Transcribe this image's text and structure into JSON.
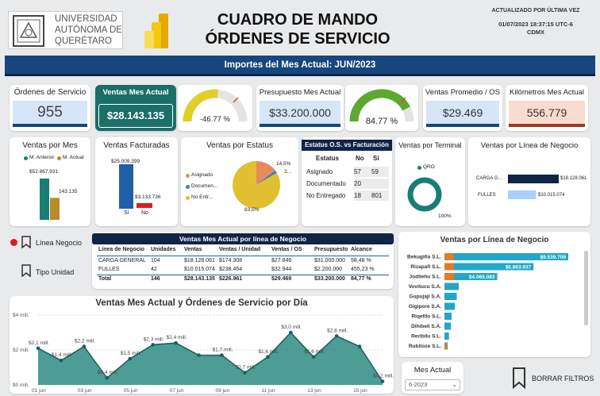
{
  "header": {
    "university": [
      "UNIVERSIDAD",
      "AUTÓNOMA DE",
      "QUERÉTARO"
    ],
    "title1": "CUADRO DE MANDO",
    "title2": "ÓRDENES DE SERVICIO",
    "updated_label": "ACTUALIZADO POR ÚLTIMA VEZ",
    "updated_value": "01/07/2023 18:37:15 UTC-6",
    "updated_tz": "CDMX"
  },
  "banner": "Importes del Mes Actual: JUN/2023",
  "colors": {
    "navy": "#0f2446",
    "blue": "#1f5fa8",
    "teal": "#1a7d73",
    "gold": "#e0b52a",
    "orange": "#e07b2a",
    "green": "#5ca832",
    "red": "#e01b1b"
  },
  "kpis": {
    "ordenes": {
      "label": "Órdenes de Servicio",
      "value": "955"
    },
    "ventas": {
      "label": "Ventas Mes Actual",
      "value": "$28.143.135"
    },
    "gauge1": {
      "value": "-46.77 %",
      "fraction": 0.53
    },
    "presupuesto": {
      "label": "Presupuesto Mes Actual",
      "value": "$33.200.000"
    },
    "gauge2": {
      "value": "84.77 %",
      "fraction": 0.8477
    },
    "promedio": {
      "label": "Ventas Promedio / OS",
      "value": "$29.469"
    },
    "km": {
      "label": "Kilómetros Mes Actual",
      "value": "556.779"
    }
  },
  "ventas_mes": {
    "title": "Ventas por Mes",
    "legend": [
      "M. Anterior",
      "M. Actual"
    ],
    "label_prev": "$52.867.931",
    "label_cur": "143.135",
    "prev": 52867931,
    "cur": 28143135
  },
  "facturadas": {
    "title": "Ventas Facturadas",
    "categories": [
      "Sí",
      "No"
    ],
    "labels": [
      "$25.009.399",
      "$3.133.736"
    ],
    "values": [
      25009399,
      3133736
    ]
  },
  "estatus": {
    "title": "Ventas por Estatus",
    "legend": [
      "Asignado",
      "Documen...",
      "No Entr..."
    ],
    "label_a": "14,5%",
    "label_b": "2...",
    "label_c": "83,5%",
    "values": [
      14.5,
      2,
      83.5
    ]
  },
  "estatus_os": {
    "title": "Estatus O.S. vs Facturación",
    "headers": [
      "Estatus",
      "No",
      "Sí"
    ],
    "rows": [
      [
        "Asignado",
        "57",
        "59"
      ],
      [
        "Documentado",
        "20",
        ""
      ],
      [
        "No Entregado",
        "18",
        "801"
      ]
    ]
  },
  "terminal": {
    "title": "Ventas por Terminal",
    "legend": "QRO",
    "pct": "100%"
  },
  "linea_small": {
    "title": "Ventas por Línea de Negocio",
    "rows": [
      {
        "name": "CARGA G...",
        "label": "$18.128.061",
        "value": 18128061
      },
      {
        "name": "FULLES",
        "label": "$10.015.074",
        "value": 10015074
      }
    ]
  },
  "bookmarks": {
    "linea": "Línea Negocio",
    "tipo": "Tipo Unidad",
    "borrar": "BORRAR FILTROS"
  },
  "tabla": {
    "title": "Ventas Mes Actual por línea de Negocio",
    "headers": [
      "Línea de Negocio",
      "Unidades",
      "Ventas",
      "Ventas / Unidad",
      "Ventas / OS",
      "Presupuesto",
      "Alcance"
    ],
    "rows": [
      [
        "CARGA GENERAL",
        "104",
        "$18.128.061",
        "$174.308",
        "$27.846",
        "$31.000.000",
        "58,48 %"
      ],
      [
        "FULLES",
        "42",
        "$10.015.074",
        "$238.454",
        "$32.944",
        "$2.200.000",
        "455,23 %"
      ]
    ],
    "total": [
      "Total",
      "146",
      "$28.143.135",
      "$226.961",
      "$29.469",
      "$33.200.000",
      "84,77 %"
    ]
  },
  "chart_data": {
    "type": "area",
    "title": "Ventas Mes Actual y Órdenes de Servicio por Día",
    "x": [
      "01 jun",
      "02 jun",
      "03 jun",
      "04 jun",
      "05 jun",
      "06 jun",
      "07 jun",
      "08 jun",
      "09 jun",
      "10 jun",
      "11 jun",
      "12 jun",
      "13 jun",
      "14 jun",
      "15 jun",
      "16 jun"
    ],
    "y": [
      2.1,
      1.4,
      2.2,
      0.4,
      1.5,
      2.3,
      2.4,
      1.7,
      1.7,
      0.7,
      1.6,
      3.0,
      1.6,
      2.8,
      2.2,
      0.2
    ],
    "point_labels": [
      "$2,1 mill.",
      "$1,4 mill.",
      "$2,2 mill.",
      "$0,4 mill.",
      "$1,5 mill.",
      "$2,3 mill.",
      "$2,4 mill.",
      "",
      "$1,7 mill.",
      "$0,7 mill.",
      "$1,6 mill.",
      "$3,0 mill.",
      "$1,6 mill.",
      "$2,8 mill.",
      "",
      "$0,2 mill."
    ],
    "xticks": [
      "01 jun",
      "03 jun",
      "05 jun",
      "07 jun",
      "09 jun",
      "11 jun",
      "13 jun",
      "15 jun"
    ],
    "yticks": [
      "$4 mill.",
      "$2 mill.",
      "$0 mill."
    ],
    "ylim": [
      0,
      4
    ]
  },
  "linea_big": {
    "title": "Ventas por Línea de Negocio",
    "rows": [
      {
        "name": "Bekugiña S.L.",
        "label": "$9.539.709",
        "value": 9539709,
        "carga": 1
      },
      {
        "name": "Rizapafi S.L.",
        "label": "$6.863.937",
        "value": 6863937,
        "carga": 1
      },
      {
        "name": "Jodilehu S.L.",
        "label": "$4.065.083",
        "value": 4065083,
        "carga": 1
      },
      {
        "name": "Vovitucu S.A.",
        "label": "",
        "value": 1100000,
        "carga": 0
      },
      {
        "name": "Gupujaji S.A.",
        "label": "",
        "value": 950000,
        "carga": 0
      },
      {
        "name": "Gigipore S.A.",
        "label": "",
        "value": 800000,
        "carga": 0
      },
      {
        "name": "Riqefilo S.L.",
        "label": "",
        "value": 550000,
        "carga": 0
      },
      {
        "name": "Dihibeli S.A.",
        "label": "",
        "value": 500000,
        "carga": 0
      },
      {
        "name": "Reribilu S.L.",
        "label": "",
        "value": 350000,
        "carga": 0
      },
      {
        "name": "Rubitoze S.L.",
        "label": "",
        "value": 150000,
        "carga": 1
      }
    ]
  },
  "mes": {
    "label": "Mes Actual",
    "value": "6-2023"
  }
}
